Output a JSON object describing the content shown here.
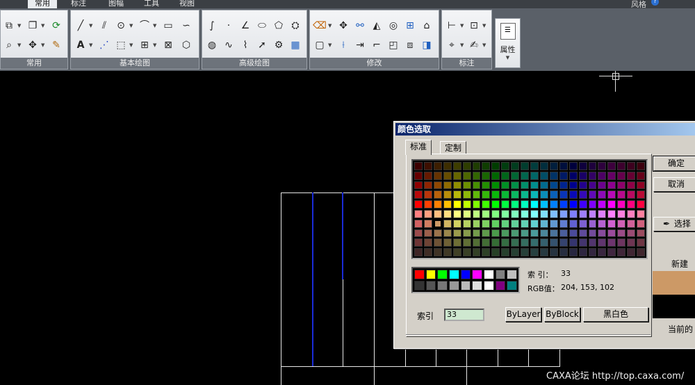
{
  "menu": {
    "tabs": [
      "常用",
      "标注",
      "图幅",
      "工具",
      "视图"
    ],
    "active_tab": 0,
    "style_label": "风格"
  },
  "ribbon": {
    "groups": [
      {
        "label": "常用"
      },
      {
        "label": "基本绘图"
      },
      {
        "label": "高级绘图"
      },
      {
        "label": "修改"
      },
      {
        "label": "标注"
      }
    ],
    "attr_button": "属性"
  },
  "dialog": {
    "title": "颜色选取",
    "tabs": [
      "标准",
      "定制"
    ],
    "index_info_label": "索 引：",
    "index_info_value": "33",
    "rgb_label": "RGB值：",
    "rgb_value": "204, 153, 102",
    "index_field_label": "索引",
    "index_field_value": "33",
    "buttons": {
      "ok": "确定",
      "cancel": "取消",
      "pick": "选择",
      "bylayer": "ByLayer",
      "byblock": "ByBlock",
      "blackwhite": "黑白色"
    },
    "new_label": "新建",
    "current_label": "当前的",
    "new_color": "#cc9966",
    "current_color": "#000000",
    "basic_colors": [
      "#ff0000",
      "#ffff00",
      "#00ff00",
      "#00ffff",
      "#0000ff",
      "#ff00ff",
      "#ffffff",
      "#808080",
      "#c0c0c0",
      "#333333",
      "#555555",
      "#777777",
      "#999999",
      "#bbbbbb",
      "#dddddd",
      "#ffffff",
      "#800080",
      "#008080"
    ],
    "selected_cell": {
      "row": 6,
      "col": 2
    }
  },
  "watermark": "CAXA论坛 http://top.caxa.com/"
}
